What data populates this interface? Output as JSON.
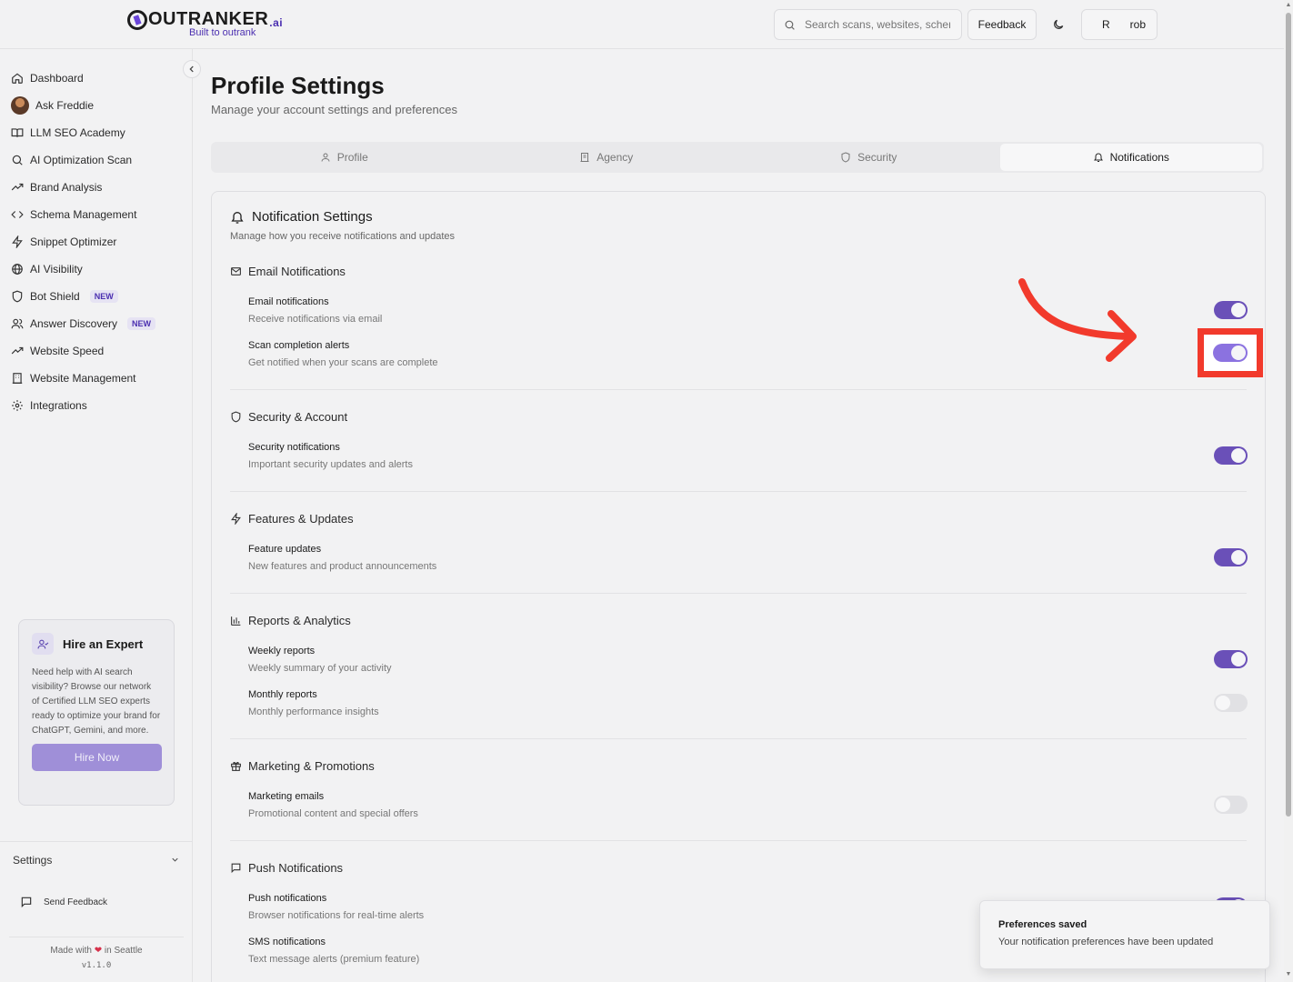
{
  "header": {
    "logo_text": "OUTRANKER",
    "logo_suffix": ".ai",
    "logo_tagline": "Built to outrank",
    "search_placeholder": "Search scans, websites, schemas...",
    "feedback_label": "Feedback",
    "user_initial": "R",
    "user_name": "rob"
  },
  "sidebar": {
    "items": [
      {
        "label": "Dashboard",
        "icon": "home-icon"
      },
      {
        "label": "Ask Freddie",
        "icon": "avatar"
      },
      {
        "label": "LLM SEO Academy",
        "icon": "book-icon"
      },
      {
        "label": "AI Optimization Scan",
        "icon": "search-icon"
      },
      {
        "label": "Brand Analysis",
        "icon": "trend-icon"
      },
      {
        "label": "Schema Management",
        "icon": "code-icon"
      },
      {
        "label": "Snippet Optimizer",
        "icon": "lightning-icon"
      },
      {
        "label": "AI Visibility",
        "icon": "globe-icon"
      },
      {
        "label": "Bot Shield",
        "icon": "shield-icon",
        "badge": "NEW"
      },
      {
        "label": "Answer Discovery",
        "icon": "users-icon",
        "badge": "NEW"
      },
      {
        "label": "Website Speed",
        "icon": "trend-icon"
      },
      {
        "label": "Website Management",
        "icon": "building-icon"
      },
      {
        "label": "Integrations",
        "icon": "gear-icon"
      }
    ],
    "hire": {
      "title": "Hire an Expert",
      "text": "Need help with AI search visibility? Browse our network of Certified LLM SEO experts ready to optimize your brand for ChatGPT, Gemini, and more.",
      "button": "Hire Now"
    },
    "settings_label": "Settings",
    "send_feedback": "Send Feedback",
    "made_with": "Made with",
    "in_city": "in Seattle",
    "version": "v1.1.0"
  },
  "page": {
    "title": "Profile Settings",
    "subtitle": "Manage your account settings and preferences"
  },
  "tabs": [
    {
      "label": "Profile",
      "icon": "user-icon"
    },
    {
      "label": "Agency",
      "icon": "building-icon"
    },
    {
      "label": "Security",
      "icon": "shield-icon"
    },
    {
      "label": "Notifications",
      "icon": "bell-icon",
      "active": true
    }
  ],
  "notifications": {
    "title": "Notification Settings",
    "subtitle": "Manage how you receive notifications and updates",
    "sections": [
      {
        "title": "Email Notifications",
        "icon": "mail-icon",
        "rows": [
          {
            "label": "Email notifications",
            "desc": "Receive notifications via email",
            "on": true
          },
          {
            "label": "Scan completion alerts",
            "desc": "Get notified when your scans are complete",
            "on": true
          }
        ]
      },
      {
        "title": "Security & Account",
        "icon": "shield-icon",
        "rows": [
          {
            "label": "Security notifications",
            "desc": "Important security updates and alerts",
            "on": true
          }
        ]
      },
      {
        "title": "Features & Updates",
        "icon": "lightning-icon",
        "rows": [
          {
            "label": "Feature updates",
            "desc": "New features and product announcements",
            "on": true
          }
        ]
      },
      {
        "title": "Reports & Analytics",
        "icon": "bar-chart-icon",
        "rows": [
          {
            "label": "Weekly reports",
            "desc": "Weekly summary of your activity",
            "on": true
          },
          {
            "label": "Monthly reports",
            "desc": "Monthly performance insights",
            "on": false
          }
        ]
      },
      {
        "title": "Marketing & Promotions",
        "icon": "gift-icon",
        "rows": [
          {
            "label": "Marketing emails",
            "desc": "Promotional content and special offers",
            "on": false
          }
        ]
      },
      {
        "title": "Push Notifications",
        "icon": "message-icon",
        "rows": [
          {
            "label": "Push notifications",
            "desc": "Browser notifications for real-time alerts",
            "on": true
          },
          {
            "label": "SMS notifications",
            "desc": "Text message alerts (premium feature)",
            "on": false
          }
        ]
      }
    ]
  },
  "toast": {
    "title": "Preferences saved",
    "text": "Your notification preferences have been updated"
  },
  "colors": {
    "accent": "#6a50b8",
    "annotation": "#f23a2c"
  }
}
